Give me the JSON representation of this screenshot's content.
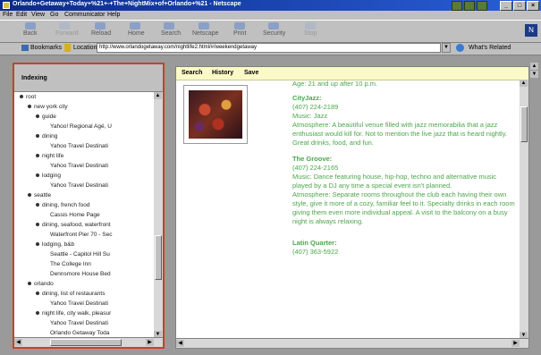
{
  "window": {
    "title": "Orlando+Getaway+Today+%21+-+The+NightMix+of+Orlando+%21 - Netscape"
  },
  "menu": [
    "File",
    "Edit",
    "View",
    "Go",
    "Communicator",
    "Help"
  ],
  "toolbar": {
    "buttons": [
      "Back",
      "Forward",
      "Reload",
      "Home",
      "Search",
      "Netscape",
      "Print",
      "Security",
      "Stop"
    ]
  },
  "location": {
    "bookmarks_label": "Bookmarks",
    "location_label": "Location:",
    "url": "http://www.orlandogetaway.com/nightlife2.html/#/weekendgetaway",
    "related_label": "What's Related"
  },
  "sidebar": {
    "title": "Indexing",
    "tree": [
      {
        "label": "root",
        "indent": 0,
        "pin": true
      },
      {
        "label": "new york city",
        "indent": 1,
        "pin": true
      },
      {
        "label": "guide",
        "indent": 2,
        "pin": true
      },
      {
        "label": "Yahoo! Regional Agé, U",
        "indent": 3,
        "pin": false
      },
      {
        "label": "dining",
        "indent": 2,
        "pin": true
      },
      {
        "label": "Yahoo Travel Destinati",
        "indent": 3,
        "pin": false
      },
      {
        "label": "night life",
        "indent": 2,
        "pin": true
      },
      {
        "label": "Yahoo Travel Destinati",
        "indent": 3,
        "pin": false
      },
      {
        "label": "lodging",
        "indent": 2,
        "pin": true
      },
      {
        "label": "Yahoo Travel Destinati",
        "indent": 3,
        "pin": false
      },
      {
        "label": "seattle",
        "indent": 1,
        "pin": true
      },
      {
        "label": "dining, french food",
        "indent": 2,
        "pin": true
      },
      {
        "label": "Cassis Home Page",
        "indent": 3,
        "pin": false
      },
      {
        "label": "dining, seafood, waterfront",
        "indent": 2,
        "pin": true
      },
      {
        "label": "Waterfront Pier 70 - Sec",
        "indent": 3,
        "pin": false
      },
      {
        "label": "lodging, b&b",
        "indent": 2,
        "pin": true
      },
      {
        "label": "Seattle - Capitol Hill Su",
        "indent": 3,
        "pin": false
      },
      {
        "label": "The College Inn",
        "indent": 3,
        "pin": false
      },
      {
        "label": "Dennsmore House Bed",
        "indent": 3,
        "pin": false
      },
      {
        "label": "orlando",
        "indent": 1,
        "pin": true
      },
      {
        "label": "dining, list of restaurants",
        "indent": 2,
        "pin": true
      },
      {
        "label": "Yahoo Travel Destinati",
        "indent": 3,
        "pin": false
      },
      {
        "label": "night life, city walk, pleasur",
        "indent": 2,
        "pin": true
      },
      {
        "label": "Yahoo Travel Destinati",
        "indent": 3,
        "pin": false
      },
      {
        "label": "Orlando Getaway Toda",
        "indent": 3,
        "pin": false
      }
    ]
  },
  "main": {
    "toolbar": [
      "Search",
      "History",
      "Save"
    ],
    "intro": "Age: 21 and up after 10 p.m.",
    "venues": [
      {
        "name": "CityJazz:",
        "phone": "(407) 224-2189",
        "music": "Music: Jazz",
        "atmosphere": "Atmosphere: A beautiful venue filled with jazz memorabilia that a jazz enthusiast would kill for. Not to mention the live jazz that is heard nightly. Great drinks, food, and fun."
      },
      {
        "name": "The Groove:",
        "phone": "(407) 224-2165",
        "music": "Music: Dance featuring house, hip-hop, techno and alternative music played by a DJ any time a special event isn't planned.",
        "atmosphere": "Atmosphere: Separate rooms throughout the club each having their own style, give it more of a cozy, familiar feel to it. Specialty drinks in each room giving them even more individual appeal. A visit to the balcony on a busy night is always relaxing."
      },
      {
        "name": "Latin Quarter:",
        "phone": "(407) 363-5922",
        "music": "",
        "atmosphere": ""
      }
    ]
  }
}
